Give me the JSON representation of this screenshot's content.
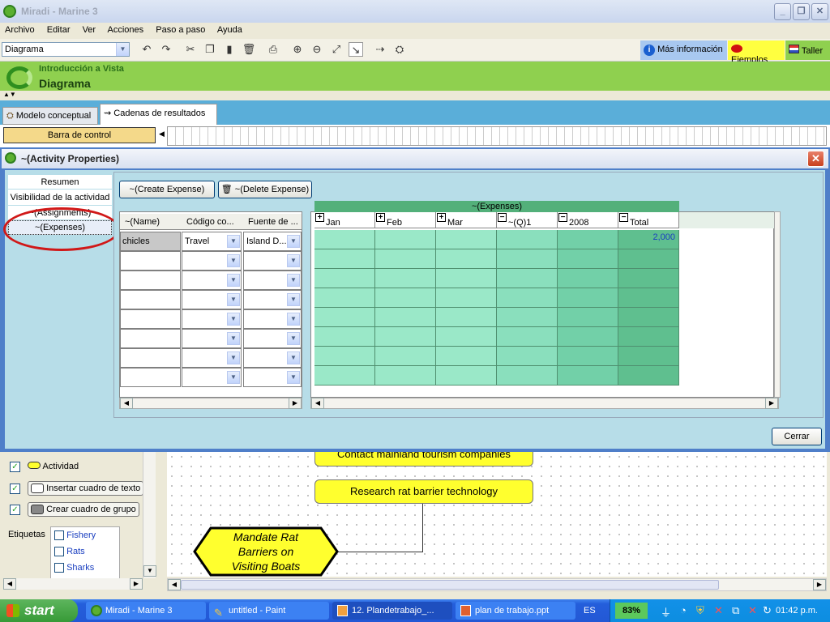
{
  "app": {
    "title": "Miradi - Marine 3",
    "menu": [
      "Archivo",
      "Editar",
      "Ver",
      "Acciones",
      "Paso a paso",
      "Ayuda"
    ],
    "view_select": "Diagrama",
    "help_buttons": {
      "more_info": "Más información",
      "examples": "Ejemplos",
      "workshop": "Taller"
    },
    "banner": {
      "subtitle": "Introducción a Vista",
      "title": "Diagrama"
    },
    "tabs": [
      "Modelo conceptual",
      "Cadenas de resultados"
    ],
    "control_bar": "Barra de control"
  },
  "dialog": {
    "title": "~(Activity Properties)",
    "nav": [
      "Resumen",
      "Visibilidad de la actividad",
      "~(Assignments)",
      "~(Expenses)"
    ],
    "create_button": "~(Create Expense)",
    "delete_button": "~(Delete Expense)",
    "table": {
      "headers": [
        "~(Name)",
        "Código co...",
        "Fuente de ..."
      ],
      "rows": [
        {
          "name": "chicles",
          "code": "Travel",
          "source": "Island D..."
        }
      ]
    },
    "grid": {
      "group_label": "~(Expenses)",
      "columns": [
        "Jan",
        "Feb",
        "Mar",
        "~(Q)1",
        "2008",
        "Total"
      ],
      "first_total": "2,000"
    },
    "close_button": "Cerrar"
  },
  "sidebar": {
    "checks": [
      "Actividad",
      "Insertar cuadro de texto",
      "Crear cuadro de grupo"
    ],
    "tags_label": "Etiquetas",
    "tags": [
      "Fishery",
      "Rats",
      "Sharks"
    ]
  },
  "diagram": {
    "node_partial": "Contact mainland tourism companies",
    "node_research": "Research rat barrier technology",
    "strategy": [
      "Mandate Rat",
      "Barriers on",
      "Visiting Boats"
    ]
  },
  "taskbar": {
    "start": "start",
    "items": [
      "Miradi - Marine 3",
      "untitled - Paint",
      "12. Plandetrabajo_...",
      "plan de trabajo.ppt"
    ],
    "lang": "ES",
    "battery": "83%",
    "time": "01:42 p.m."
  },
  "colors": {
    "accent_green": "#8fd04f",
    "grid_header": "#53b07a",
    "dialog_border": "#4f7fc9"
  }
}
